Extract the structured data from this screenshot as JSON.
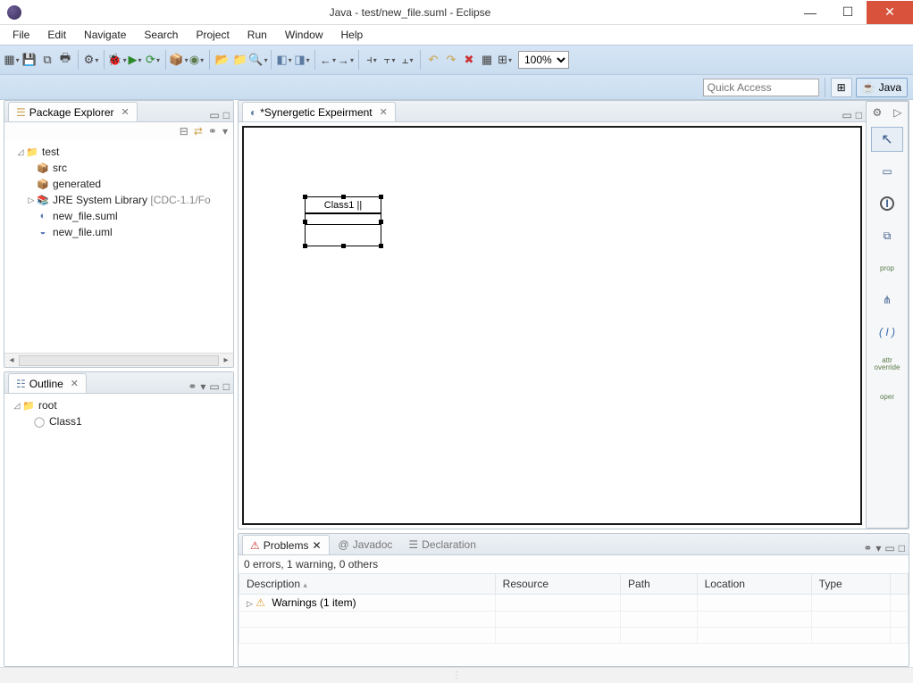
{
  "window": {
    "title": "Java - test/new_file.suml - Eclipse"
  },
  "menu": [
    "File",
    "Edit",
    "Navigate",
    "Search",
    "Project",
    "Run",
    "Window",
    "Help"
  ],
  "toolbar": {
    "zoom": "100%"
  },
  "quickaccess": {
    "placeholder": "Quick Access"
  },
  "perspective": {
    "java_label": "Java"
  },
  "package_explorer": {
    "title": "Package Explorer",
    "project": "test",
    "src": "src",
    "generated": "generated",
    "jre": "JRE System Library",
    "jre_profile": "[CDC-1.1/Fo",
    "file1": "new_file.suml",
    "file2": "new_file.uml"
  },
  "outline": {
    "title": "Outline",
    "root": "root",
    "class1": "Class1"
  },
  "editor": {
    "tab_title": "*Synergetic Expeirment",
    "class_name": "Class1 ||"
  },
  "palette": {
    "prop": "prop",
    "attr_override": "attr\noverride",
    "oper": "oper",
    "bracket": "( I )"
  },
  "problems": {
    "tab_problems": "Problems",
    "tab_javadoc": "Javadoc",
    "tab_declaration": "Declaration",
    "summary": "0 errors, 1 warning, 0 others",
    "col_description": "Description",
    "col_resource": "Resource",
    "col_path": "Path",
    "col_location": "Location",
    "col_type": "Type",
    "warnings_row": "Warnings (1 item)"
  }
}
